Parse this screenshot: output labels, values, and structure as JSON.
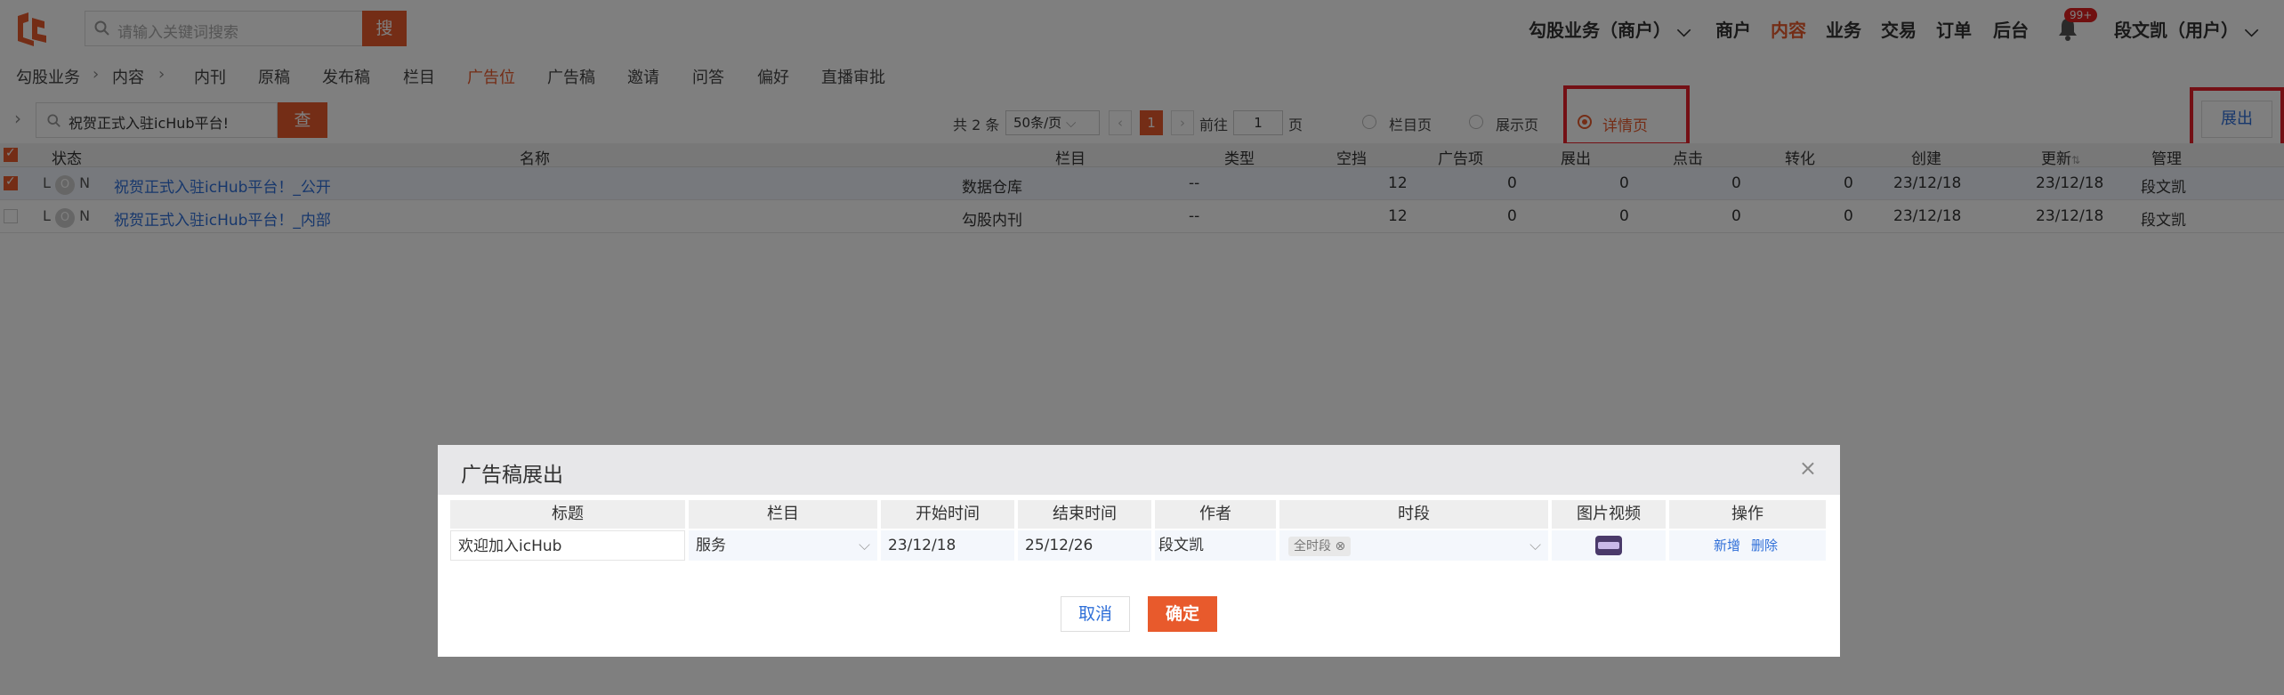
{
  "header": {
    "search_placeholder": "请输入关键词搜索",
    "search_button": "搜",
    "business_menu": "勾股业务（商户）",
    "nav": [
      "商户",
      "内容",
      "业务",
      "交易",
      "订单",
      "后台"
    ],
    "notification_badge": "99+",
    "user_menu": "段文凯（用户）"
  },
  "subnav": {
    "breadcrumb": [
      "勾股业务",
      "内容"
    ],
    "items": [
      "内刊",
      "原稿",
      "发布稿",
      "栏目",
      "广告位",
      "广告稿",
      "邀请",
      "问答",
      "偏好",
      "直播审批"
    ],
    "active": "广告位"
  },
  "toolbar": {
    "query_value": "祝贺正式入驻icHub平台!",
    "query_button": "查",
    "total": "共 2 条",
    "page_size": "50条/页",
    "current_page": "1",
    "goto_label": "前往",
    "goto_value": "1",
    "page_label": "页",
    "radios": [
      "栏目页",
      "展示页",
      "详情页"
    ],
    "selected_radio": "详情页",
    "export_button": "展出"
  },
  "table": {
    "headers": [
      "状态",
      "名称",
      "栏目",
      "类型",
      "空挡",
      "广告项",
      "展出",
      "点击",
      "转化",
      "创建",
      "更新",
      "管理"
    ],
    "rows": [
      {
        "status_l": "L",
        "status_o": "O",
        "status_n": "N",
        "name": "祝贺正式入驻icHub平台！_公开",
        "column": "数据仓库",
        "type": "--",
        "gap": "12",
        "ads": "0",
        "shows": "0",
        "clicks": "0",
        "conv": "0",
        "created": "23/12/18",
        "updated": "23/12/18",
        "manager": "段文凯",
        "checked": true
      },
      {
        "status_l": "L",
        "status_o": "O",
        "status_n": "N",
        "name": "祝贺正式入驻icHub平台！_内部",
        "column": "勾股内刊",
        "type": "--",
        "gap": "12",
        "ads": "0",
        "shows": "0",
        "clicks": "0",
        "conv": "0",
        "created": "23/12/18",
        "updated": "23/12/18",
        "manager": "段文凯",
        "checked": false
      }
    ]
  },
  "modal": {
    "title": "广告稿展出",
    "headers": [
      "标题",
      "栏目",
      "开始时间",
      "结束时间",
      "作者",
      "时段",
      "图片视频",
      "操作"
    ],
    "row": {
      "title": "欢迎加入icHub",
      "column": "服务",
      "start": "23/12/18",
      "end": "25/12/26",
      "author": "段文凯",
      "period_tag": "全时段",
      "action_add": "新增",
      "action_delete": "删除"
    },
    "cancel": "取消",
    "confirm": "确定"
  },
  "colors": {
    "accent": "#e85a2c",
    "link": "#2f6fd8",
    "highlight_border": "#e8202a"
  }
}
